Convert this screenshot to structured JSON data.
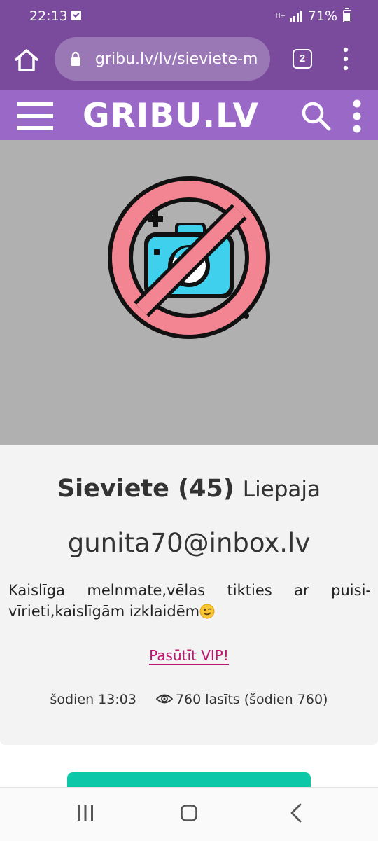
{
  "status_bar": {
    "time": "22:13",
    "network": "H+",
    "battery": "71%"
  },
  "browser": {
    "url": "gribu.lv/lv/sieviete-m",
    "tab_count": "2"
  },
  "site": {
    "logo": "GRIBU.LV"
  },
  "profile": {
    "name_age": "Sieviete (45)",
    "city": "Liepaja",
    "contact": "gunita70@inbox.lv",
    "description": "Kaislīga melnmate,vēlas tikties ar puisi-vīrieti,kaislīgām izklaidēm",
    "vip_link": "Pasūtīt VIP!",
    "posted": "šodien 13:03",
    "views": "760 lasīts (šodien 760)"
  },
  "colors": {
    "browser_bar": "#7a4a9c",
    "site_header": "#9a69c7",
    "vip_link": "#c0146e",
    "action_button": "#0cc8a8"
  },
  "icons": [
    "home-icon",
    "lock-icon",
    "tabs-icon",
    "menu-dots-icon",
    "hamburger-icon",
    "search-icon",
    "no-photo-icon",
    "wink-emoji-icon",
    "eye-icon",
    "recent-apps-icon",
    "home-nav-icon",
    "back-icon"
  ]
}
